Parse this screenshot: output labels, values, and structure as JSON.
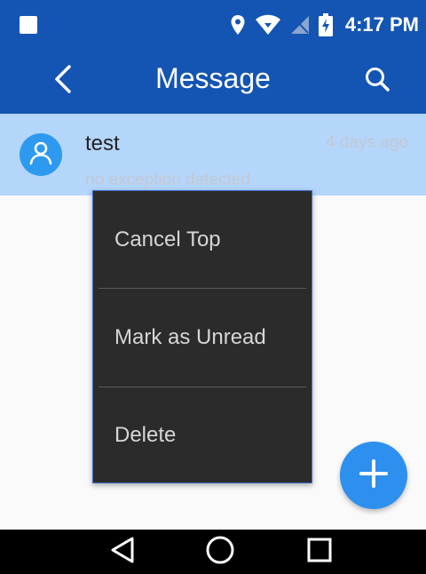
{
  "status_bar": {
    "time": "4:17 PM",
    "icons": [
      "notification-square-icon",
      "location-pin-icon",
      "wifi-icon",
      "no-sim-icon",
      "battery-charging-icon"
    ]
  },
  "app_bar": {
    "title": "Message",
    "back_icon": "chevron-left-icon",
    "search_icon": "search-icon"
  },
  "messages": [
    {
      "name": "test",
      "time": "4 days ago",
      "preview": "no exception detected",
      "avatar_icon": "person-icon"
    }
  ],
  "context_menu": {
    "items": [
      {
        "label": "Cancel Top"
      },
      {
        "label": "Mark as Unread"
      },
      {
        "label": "Delete"
      }
    ]
  },
  "fab": {
    "icon": "plus-icon"
  },
  "nav_bar": {
    "icons": [
      "back-triangle-icon",
      "home-circle-icon",
      "recents-square-icon"
    ]
  },
  "colors": {
    "primary": "#1455b3",
    "selected_row": "#b5d6fb",
    "avatar": "#2d9af0",
    "fab": "#2d90ef",
    "menu_bg": "#2b2b2b",
    "menu_text": "#d6d6d6",
    "secondary_text": "#c2c8d0"
  }
}
